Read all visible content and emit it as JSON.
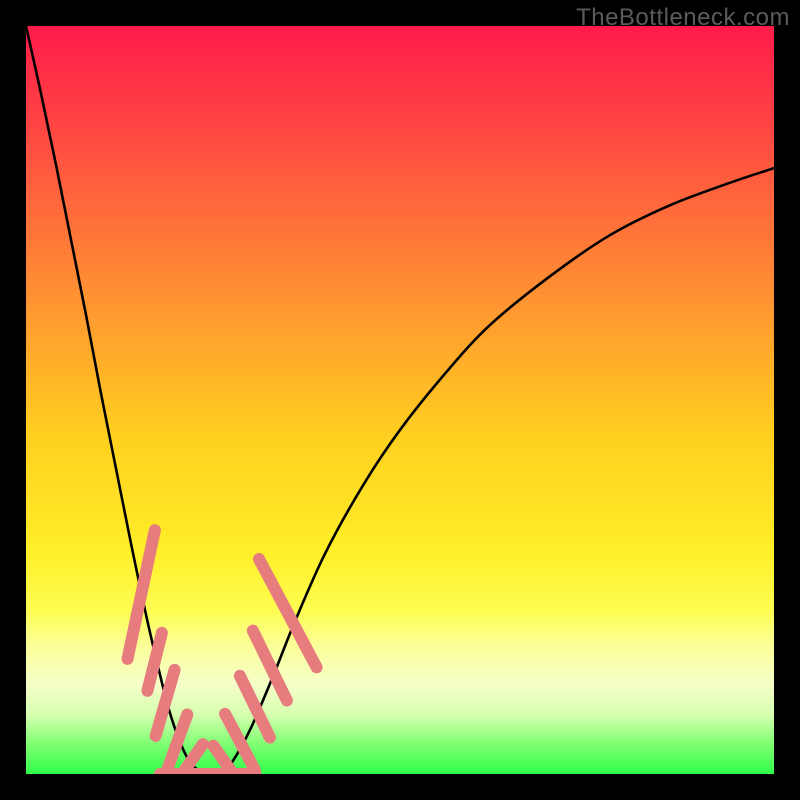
{
  "watermark": "TheBottleneck.com",
  "chart_data": {
    "type": "line",
    "title": "",
    "xlabel": "",
    "ylabel": "",
    "xlim": [
      0,
      100
    ],
    "ylim": [
      0,
      100
    ],
    "grid": false,
    "legend": false,
    "background_gradient_stops": [
      {
        "pct": 0,
        "color": "#ff1b4a"
      },
      {
        "pct": 15,
        "color": "#ff4a42"
      },
      {
        "pct": 35,
        "color": "#ff8e33"
      },
      {
        "pct": 55,
        "color": "#ffd01f"
      },
      {
        "pct": 70,
        "color": "#ffee28"
      },
      {
        "pct": 78,
        "color": "#fdfd50"
      },
      {
        "pct": 83,
        "color": "#fbff9a"
      },
      {
        "pct": 88,
        "color": "#f5ffc8"
      },
      {
        "pct": 92,
        "color": "#d7ffb0"
      },
      {
        "pct": 96,
        "color": "#7fff72"
      },
      {
        "pct": 100,
        "color": "#2fff4a"
      }
    ],
    "series": [
      {
        "name": "bottleneck-curve",
        "color": "#000000",
        "x": [
          0.0,
          2.0,
          4.0,
          6.0,
          8.0,
          10.0,
          12.0,
          14.0,
          16.0,
          17.5,
          19.0,
          20.5,
          22.0,
          24.0,
          26.0,
          27.5,
          30.0,
          33.0,
          36.0,
          40.0,
          45.0,
          50.0,
          56.0,
          62.0,
          70.0,
          78.0,
          86.0,
          94.0,
          100.0
        ],
        "y": [
          100.0,
          91.0,
          81.5,
          71.5,
          61.5,
          51.0,
          41.0,
          31.0,
          21.5,
          15.0,
          9.0,
          4.5,
          1.5,
          0.0,
          0.0,
          1.5,
          6.0,
          13.0,
          20.5,
          29.5,
          38.5,
          46.0,
          53.5,
          60.0,
          66.5,
          72.0,
          76.0,
          79.0,
          81.0
        ]
      }
    ],
    "markers": {
      "name": "highlighted-range",
      "color": "#e77c7e",
      "shape": "rounded-capsule",
      "segments_left": [
        {
          "x": 15.4,
          "y": 24.0,
          "len": 8.0,
          "angle": -78
        },
        {
          "x": 17.2,
          "y": 15.0,
          "len": 4.0,
          "angle": -76
        },
        {
          "x": 18.6,
          "y": 9.5,
          "len": 4.5,
          "angle": -74
        },
        {
          "x": 20.2,
          "y": 4.2,
          "len": 4.0,
          "angle": -70
        },
        {
          "x": 21.7,
          "y": 1.2,
          "len": 3.5,
          "angle": -55
        }
      ],
      "segments_right": [
        {
          "x": 27.0,
          "y": 1.0,
          "len": 3.5,
          "angle": 55
        },
        {
          "x": 28.6,
          "y": 4.3,
          "len": 4.2,
          "angle": 62
        },
        {
          "x": 30.6,
          "y": 9.0,
          "len": 4.5,
          "angle": 64
        },
        {
          "x": 32.6,
          "y": 14.5,
          "len": 5.0,
          "angle": 64
        },
        {
          "x": 35.0,
          "y": 21.5,
          "len": 7.5,
          "angle": 62
        }
      ],
      "segments_bottom": [
        {
          "x": 24.3,
          "y": 0.0,
          "len": 6.0,
          "angle": 0
        }
      ]
    }
  }
}
